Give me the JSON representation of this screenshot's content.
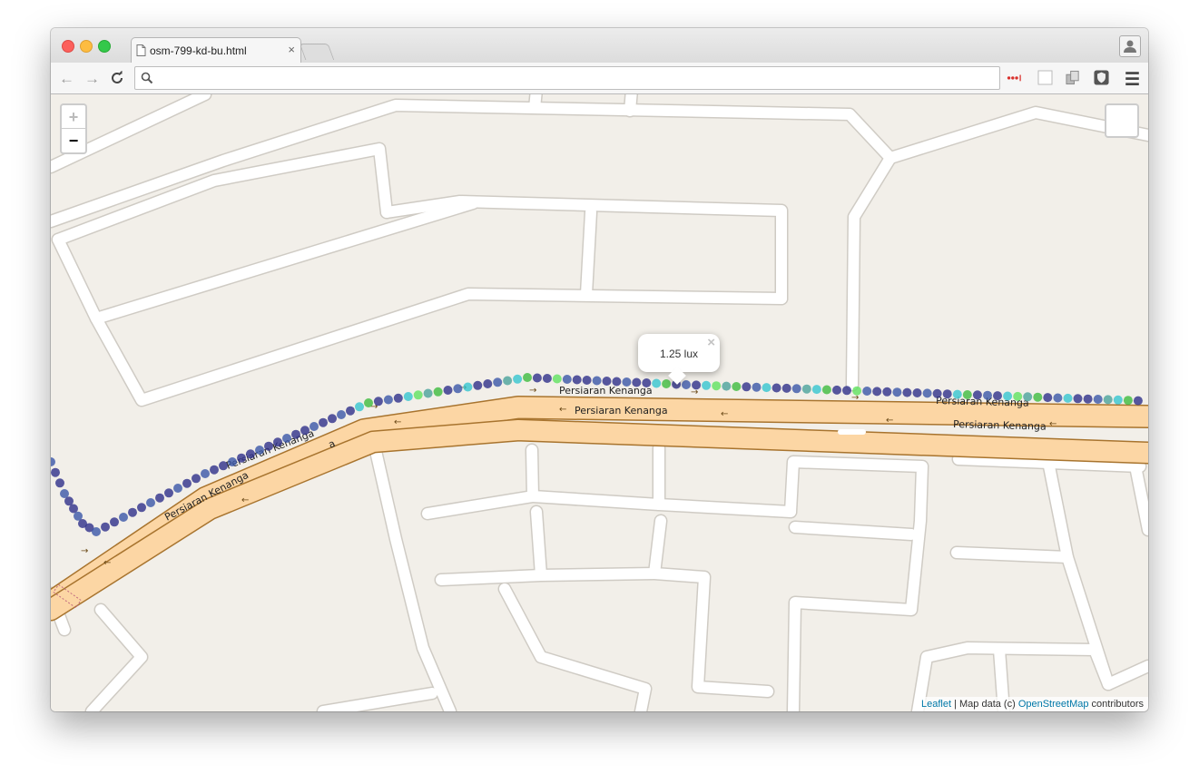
{
  "browser": {
    "tab_title": "osm-799-kd-bu.html",
    "tab_close": "×",
    "url": "",
    "icons": [
      "back-arrow-icon",
      "forward-arrow-icon",
      "reload-icon",
      "search-icon",
      "profile-icon",
      "extension-icon",
      "menu-icon"
    ]
  },
  "map": {
    "zoom_in": "+",
    "zoom_out": "−",
    "popup": {
      "text": "1.25 lux",
      "close": "×"
    },
    "street_labels": [
      "Persiaran Kenanga",
      "Persiaran Kenanga",
      "Persiaran Kenanga",
      "Persiaran Kenanga",
      "Persiaran Kenanga",
      "Persiaran Kenanga"
    ],
    "short_label": "a",
    "attribution": {
      "leaflet": "Leaflet",
      "separator": " | Map data (c) ",
      "osm": "OpenStreetMap",
      "suffix": " contributors"
    },
    "track_colors": [
      "#2e2f8a",
      "#3a56a8",
      "#35c6cf",
      "#3dbb3d",
      "#5fe25f",
      "#4aa39b"
    ]
  }
}
